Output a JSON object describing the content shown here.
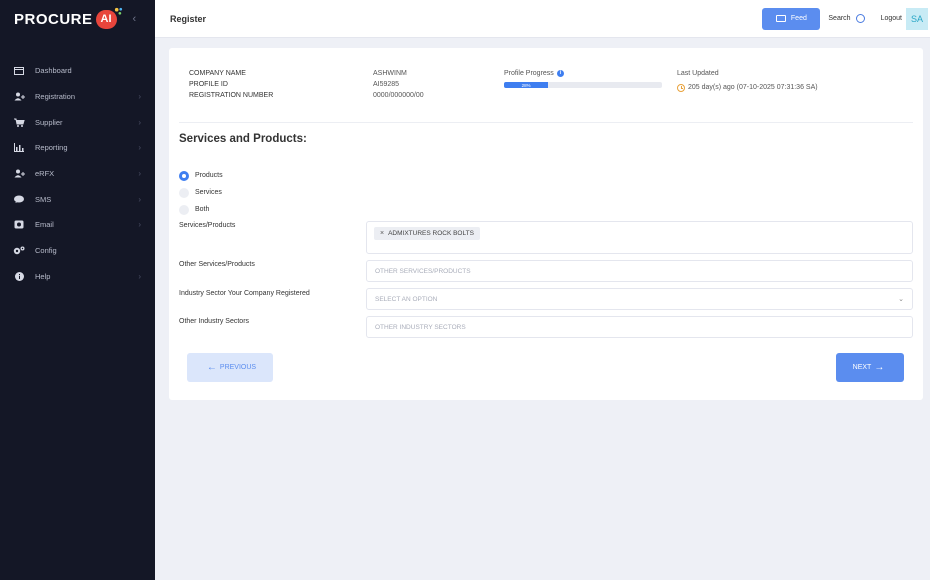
{
  "brand": {
    "name": "PROCURE",
    "ai": "AI",
    "collapse_glyph": "‹"
  },
  "sidebar": {
    "items": [
      {
        "label": "Dashboard",
        "icon": "monitor-icon",
        "has_children": false
      },
      {
        "label": "Registration",
        "icon": "user-plus-icon",
        "has_children": true
      },
      {
        "label": "Supplier",
        "icon": "cart-icon",
        "has_children": true
      },
      {
        "label": "Reporting",
        "icon": "chart-icon",
        "has_children": true
      },
      {
        "label": "eRFX",
        "icon": "user-plus-icon",
        "has_children": true
      },
      {
        "label": "SMS",
        "icon": "chat-icon",
        "has_children": true
      },
      {
        "label": "Email",
        "icon": "envelope-icon",
        "has_children": true
      },
      {
        "label": "Config",
        "icon": "gears-icon",
        "has_children": false
      },
      {
        "label": "Help",
        "icon": "info-icon",
        "has_children": true
      }
    ],
    "chevron": "›"
  },
  "topbar": {
    "title": "Register",
    "feed_label": "Feed",
    "search_label": "Search",
    "logout_label": "Logout",
    "avatar_initials": "SA"
  },
  "profile": {
    "company_name_label": "COMPANY NAME",
    "profile_id_label": "PROFILE ID",
    "registration_number_label": "REGISTRATION NUMBER",
    "company_name": "ASHWINM",
    "profile_id": "AI59285",
    "registration_number": "0000/000000/00",
    "progress_label": "Profile Progress",
    "progress_percent_text": "28%",
    "progress_value": 0.28,
    "last_updated_label": "Last Updated",
    "last_updated_value": "205 day(s) ago (07-10-2025 07:31:36 SA)"
  },
  "form": {
    "section_title": "Services and Products:",
    "radio_options": [
      {
        "label": "Products",
        "selected": true
      },
      {
        "label": "Services",
        "selected": false
      },
      {
        "label": "Both",
        "selected": false
      }
    ],
    "services_products_label": "Services/Products",
    "selected_chip": "ADMIXTURES ROCK BOLTS",
    "other_services_label": "Other Services/Products",
    "other_services_placeholder": "OTHER SERVICES/PRODUCTS",
    "industry_sector_label": "Industry Sector Your Company Registered",
    "industry_sector_placeholder": "SELECT AN OPTION",
    "other_industry_label": "Other Industry Sectors",
    "other_industry_placeholder": "OTHER INDUSTRY SECTORS"
  },
  "actions": {
    "previous_label": "PREVIOUS",
    "next_label": "NEXT"
  },
  "colors": {
    "sidebar_bg": "#141726",
    "accent": "#5b8def",
    "progress": "#3e7ef0",
    "warning": "#e9a23b"
  }
}
